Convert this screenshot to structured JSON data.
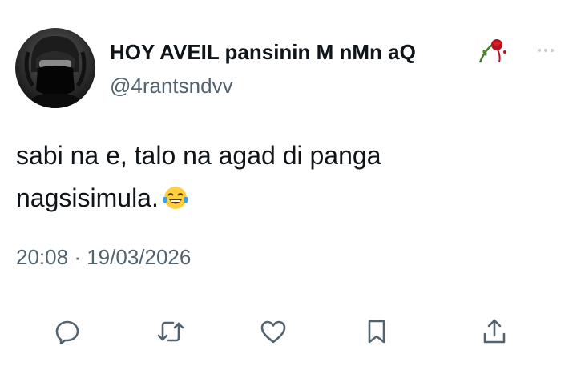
{
  "tweet": {
    "display_name": "HOY AVEIL pansinin M nMn aQ",
    "handle": "@4rantsndvv",
    "text_line1": "sabi na e, talo na agad di panga",
    "text_line2": "nagsisimula.",
    "time": "20:08",
    "separator": "·",
    "date": "19/03/2026"
  },
  "icons": {
    "name_emoji": "wilted-rose-icon",
    "text_emoji": "tears-of-joy-emoji",
    "more": "more-options-icon",
    "actions": [
      "reply-icon",
      "retweet-icon",
      "like-icon",
      "bookmark-icon",
      "share-icon"
    ]
  },
  "colors": {
    "text_primary": "#0f1419",
    "text_secondary": "#536471",
    "icon": "#536471"
  }
}
